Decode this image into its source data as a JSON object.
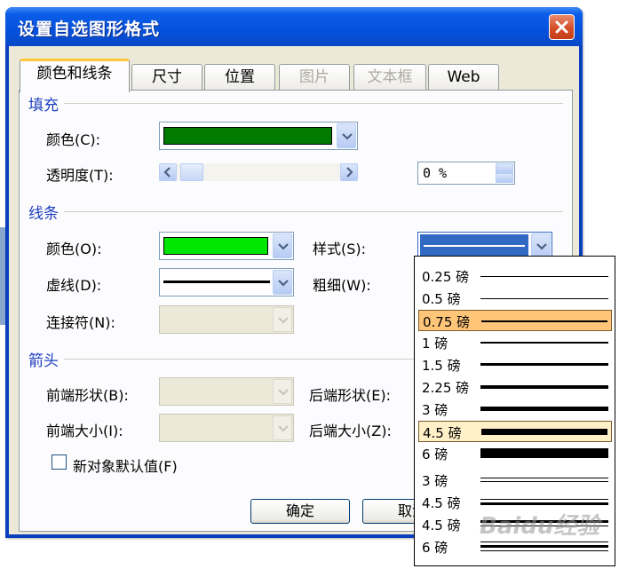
{
  "window": {
    "title": "设置自选图形格式"
  },
  "tabs": [
    {
      "label": "颜色和线条",
      "active": true
    },
    {
      "label": "尺寸"
    },
    {
      "label": "位置"
    },
    {
      "label": "图片",
      "disabled": true
    },
    {
      "label": "文本框",
      "disabled": true
    },
    {
      "label": "Web"
    }
  ],
  "fill": {
    "heading": "填充",
    "color_label": "颜色(C):",
    "color_value": "#007a00",
    "transparency_label": "透明度(T):",
    "transparency_value": "0 %"
  },
  "line": {
    "heading": "线条",
    "color_label": "颜色(O):",
    "color_value": "#00e600",
    "style_label": "样式(S):",
    "dash_label": "虚线(D):",
    "weight_label": "粗细(W):",
    "connector_label": "连接符(N):"
  },
  "arrows": {
    "heading": "箭头",
    "begin_style_label": "前端形状(B):",
    "end_style_label": "后端形状(E):",
    "begin_size_label": "前端大小(I):",
    "end_size_label": "后端大小(Z):"
  },
  "default_checkbox_label": "新对象默认值(F)",
  "buttons": {
    "ok": "确定",
    "cancel": "取消"
  },
  "style_dropdown": {
    "options": [
      {
        "label": "0.25 磅"
      },
      {
        "label": "0.5 磅"
      },
      {
        "label": "0.75 磅",
        "state": "selected"
      },
      {
        "label": "1 磅"
      },
      {
        "label": "1.5 磅"
      },
      {
        "label": "2.25 磅"
      },
      {
        "label": "3 磅"
      },
      {
        "label": "4.5 磅",
        "state": "hover"
      },
      {
        "label": "6 磅"
      },
      {
        "label": "3 磅"
      },
      {
        "label": "4.5 磅"
      },
      {
        "label": "4.5 磅"
      },
      {
        "label": "6 磅"
      }
    ]
  },
  "watermark": "Baidu经验",
  "icons": {
    "close": "close-icon",
    "dropdown": "chevron-down-icon",
    "scroll_left": "chevron-left-icon",
    "scroll_right": "chevron-right-icon"
  }
}
